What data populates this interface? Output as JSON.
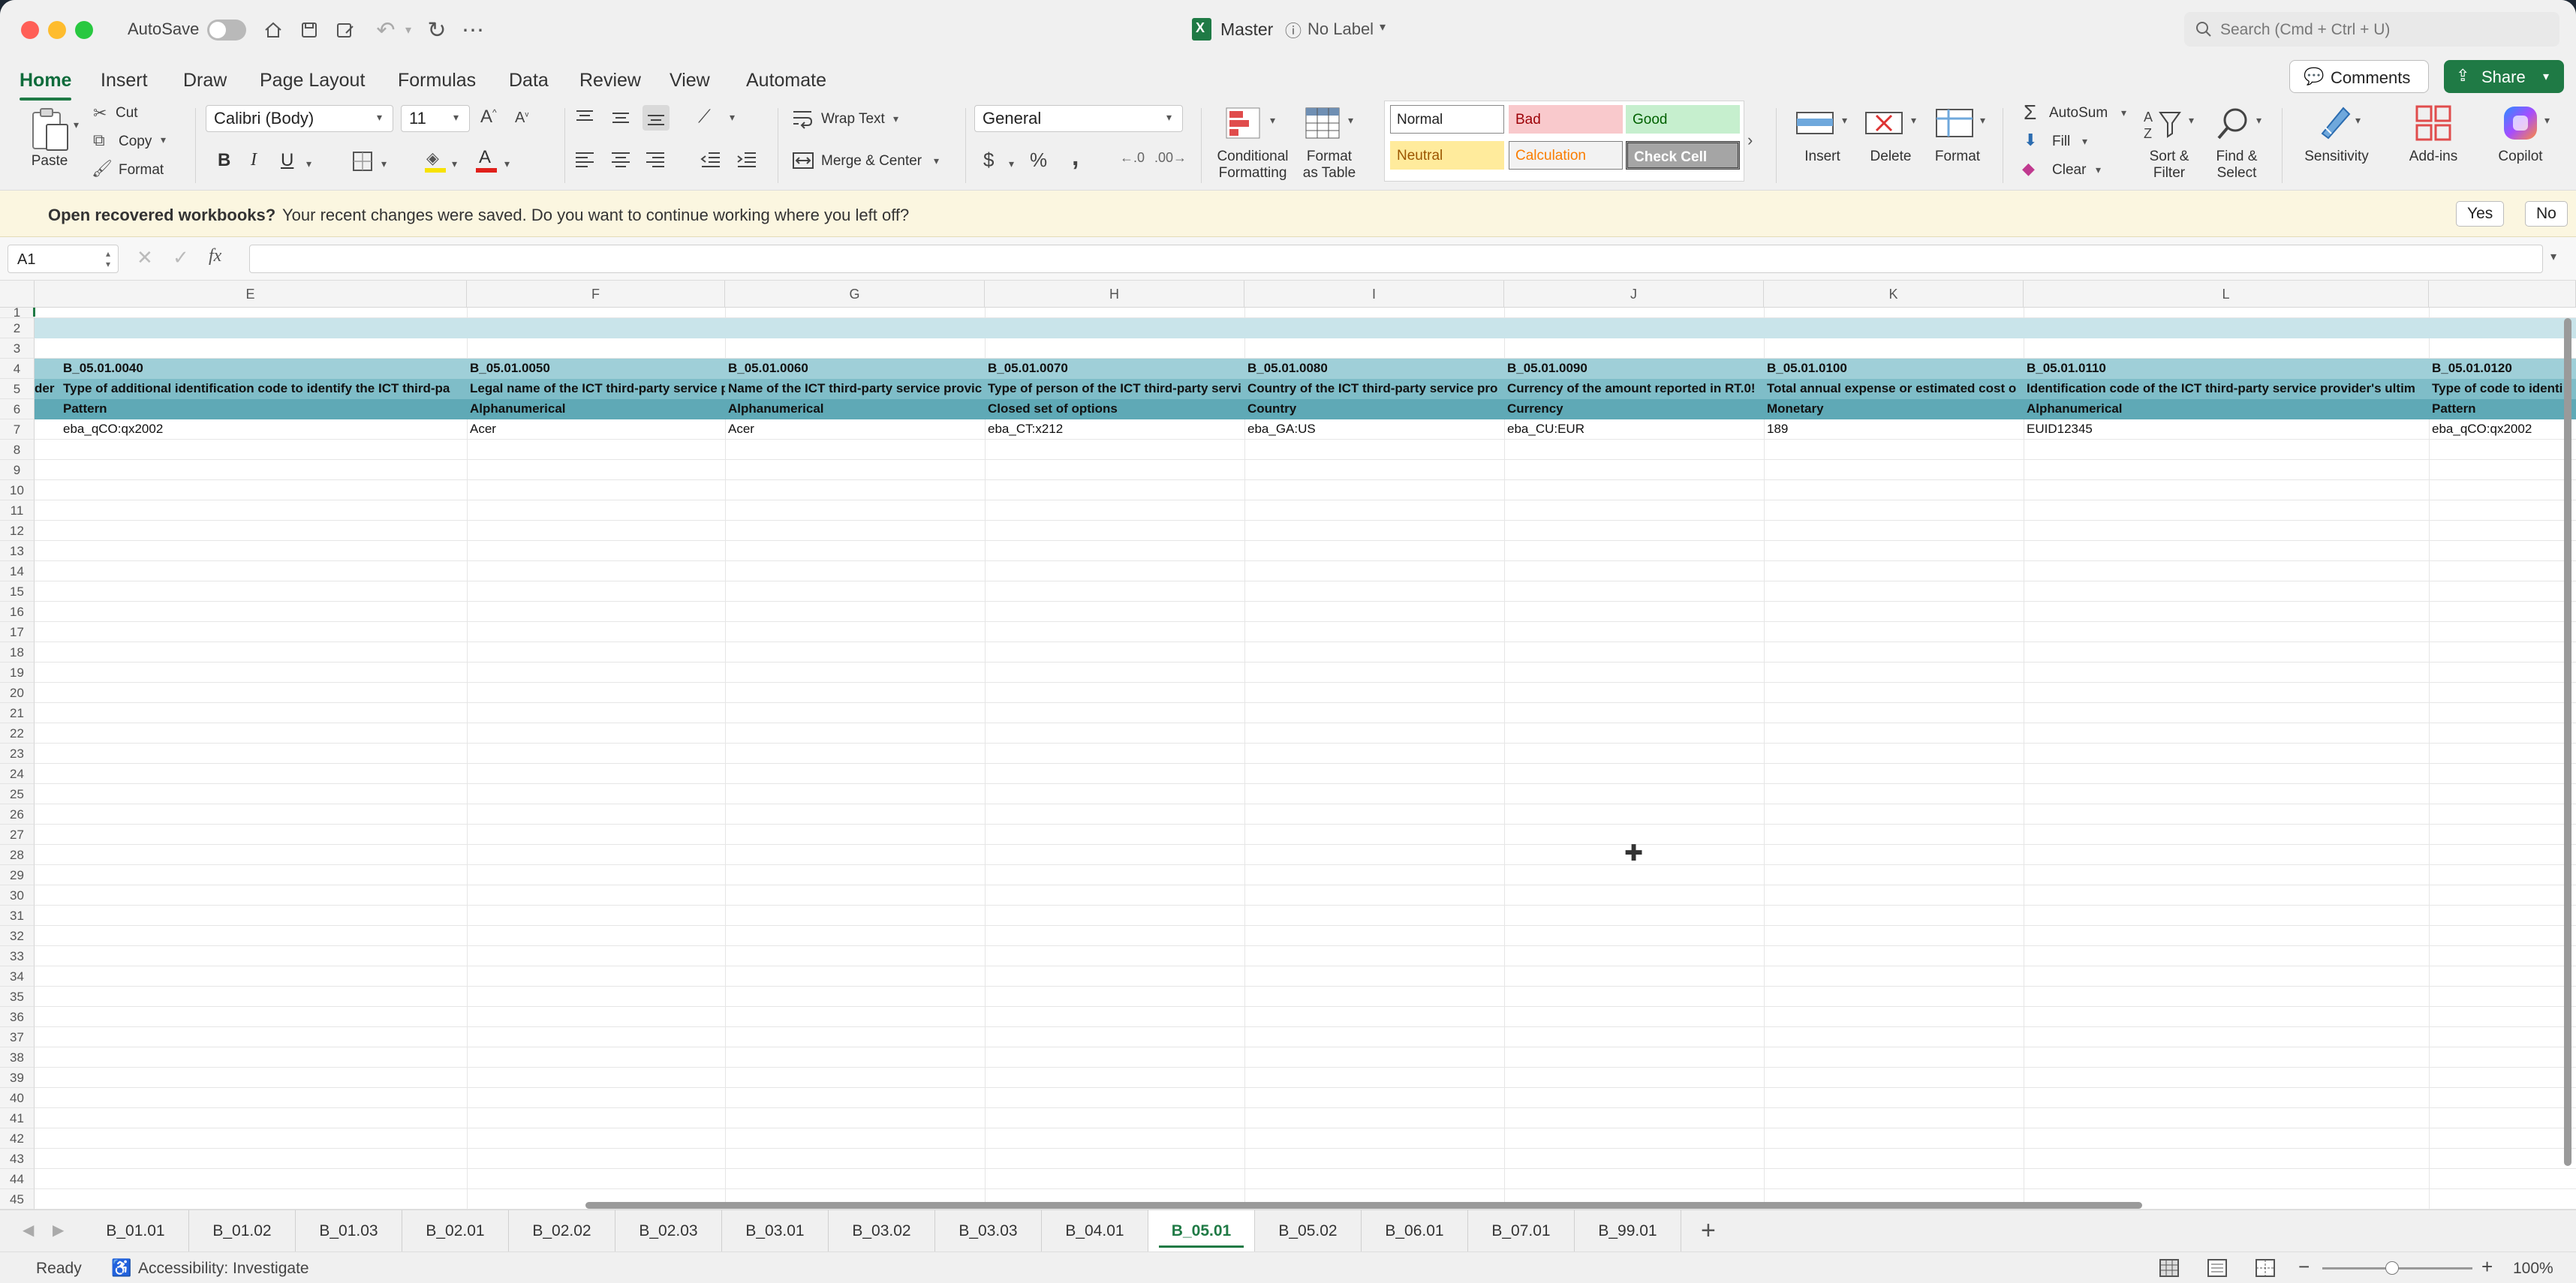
{
  "titlebar": {
    "autosave_label": "AutoSave",
    "doc_title": "Master",
    "sensitivity_label": "No Label",
    "search_placeholder": "Search (Cmd + Ctrl + U)"
  },
  "tabs": [
    "Home",
    "Insert",
    "Draw",
    "Page Layout",
    "Formulas",
    "Data",
    "Review",
    "View",
    "Automate"
  ],
  "actions": {
    "comments": "Comments",
    "share": "Share"
  },
  "ribbon": {
    "paste": "Paste",
    "cut": "Cut",
    "copy": "Copy",
    "format_painter": "Format",
    "font_name": "Calibri (Body)",
    "font_size": "11",
    "bold": "B",
    "italic": "I",
    "underline": "U",
    "wrap_text": "Wrap Text",
    "merge_center": "Merge & Center",
    "number_format": "General",
    "currency": "$",
    "percent": "%",
    "comma": ",",
    "conditional_formatting_1": "Conditional",
    "conditional_formatting_2": "Formatting",
    "format_as_table_1": "Format",
    "format_as_table_2": "as Table",
    "styles": {
      "normal": "Normal",
      "bad": "Bad",
      "good": "Good",
      "neutral": "Neutral",
      "calculation": "Calculation",
      "check_cell": "Check Cell"
    },
    "insert": "Insert",
    "delete": "Delete",
    "format": "Format",
    "autosum": "AutoSum",
    "fill": "Fill",
    "clear": "Clear",
    "sort_filter_1": "Sort &",
    "sort_filter_2": "Filter",
    "find_select_1": "Find &",
    "find_select_2": "Select",
    "sensitivity": "Sensitivity",
    "addins": "Add-ins",
    "copilot": "Copilot"
  },
  "message_bar": {
    "title": "Open recovered workbooks?",
    "text": "Your recent changes were saved. Do you want to continue working where you left off?",
    "yes": "Yes",
    "no": "No"
  },
  "formula_bar": {
    "name_box": "A1",
    "fx": "fx",
    "value": ""
  },
  "grid": {
    "columns": [
      "E",
      "F",
      "G",
      "H",
      "I",
      "J",
      "K",
      "L"
    ],
    "rows": [
      "1",
      "2",
      "3",
      "4",
      "5",
      "6",
      "7",
      "8",
      "9",
      "10",
      "11",
      "12",
      "13",
      "14",
      "15",
      "16",
      "17",
      "18",
      "19",
      "20",
      "21",
      "22",
      "23",
      "24",
      "25",
      "26",
      "27",
      "28",
      "29",
      "30",
      "31",
      "32",
      "33",
      "34",
      "35",
      "36",
      "37",
      "38",
      "39",
      "40",
      "41",
      "42",
      "43",
      "44",
      "45"
    ],
    "row4": [
      "B_05.01.0040",
      "B_05.01.0050",
      "B_05.01.0060",
      "B_05.01.0070",
      "B_05.01.0080",
      "B_05.01.0090",
      "B_05.01.0100",
      "B_05.01.0110",
      "B_05.01.0120"
    ],
    "row5_prefix": "der",
    "row5": [
      "Type of additional identification code to identify the ICT third-pa",
      "Legal name of the ICT third-party service p",
      "Name of the ICT third-party service provic",
      "Type of person of the ICT third-party servi",
      "Country of the ICT third-party service pro",
      "Currency of the amount reported in RT.0!",
      "Total annual expense or estimated cost o",
      "Identification code of the ICT third-party service provider's ultim",
      "Type of code to identi"
    ],
    "row6": [
      "Pattern",
      "Alphanumerical",
      "Alphanumerical",
      "Closed set of options",
      "Country",
      "Currency",
      "Monetary",
      "Alphanumerical",
      "Pattern"
    ],
    "row7": [
      "eba_qCO:qx2002",
      "Acer",
      "Acer",
      "eba_CT:x212",
      "eba_GA:US",
      "eba_CU:EUR",
      "189",
      "EUID12345",
      "eba_qCO:qx2002"
    ]
  },
  "sheets": [
    "B_01.01",
    "B_01.02",
    "B_01.03",
    "B_02.01",
    "B_02.02",
    "B_02.03",
    "B_03.01",
    "B_03.02",
    "B_03.03",
    "B_04.01",
    "B_05.01",
    "B_05.02",
    "B_06.01",
    "B_07.01",
    "B_99.01"
  ],
  "active_sheet": "B_05.01",
  "status": {
    "ready": "Ready",
    "accessibility": "Accessibility: Investigate",
    "zoom": "100%"
  },
  "colors": {
    "accent": "#1f7a45",
    "header_light": "#c9e4ea",
    "header_mid": "#9fcfd8",
    "header_dark": "#5fa9b6"
  }
}
